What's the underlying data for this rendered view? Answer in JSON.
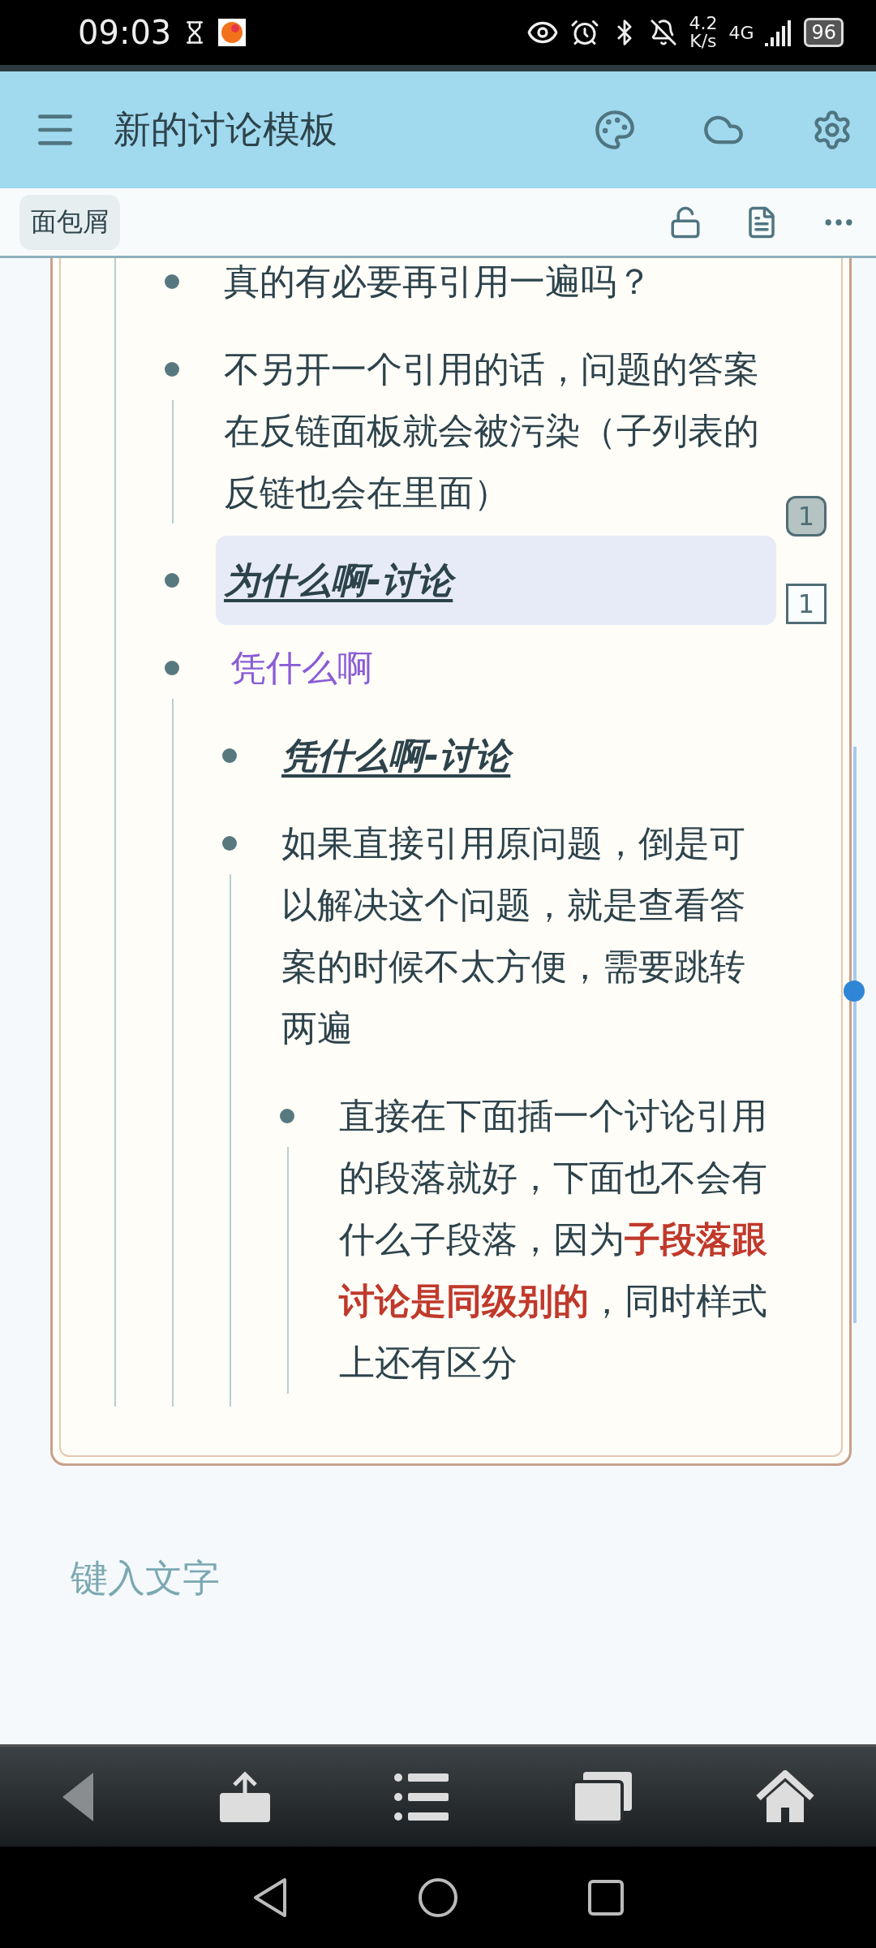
{
  "status_bar": {
    "time": "09:03",
    "speed": [
      "4.2",
      "K/s"
    ],
    "network": "4G",
    "battery": "96"
  },
  "app_bar": {
    "title": "新的讨论模板"
  },
  "toolbar": {
    "breadcrumb": "面包屑"
  },
  "outline": [
    {
      "text": "真的有必要再引用一遍吗？",
      "kind": "text",
      "selected": false
    },
    {
      "text": "不另开一个引用的话，问题的答案在反链面板就会被污染（子列表的反链也会在里面）",
      "kind": "text",
      "selected": false
    },
    {
      "text": "为什么啊-讨论",
      "kind": "reference",
      "selected": true,
      "badges": [
        {
          "label": "1",
          "filled": true
        },
        {
          "label": "1",
          "filled": false
        }
      ]
    },
    {
      "text": "凭什么啊",
      "kind": "tag",
      "selected": false,
      "children": [
        {
          "text": "凭什么啊-讨论",
          "kind": "reference",
          "selected": false
        },
        {
          "text": "如果直接引用原问题，倒是可以解决这个问题，就是查看答案的时候不太方便，需要跳转两遍",
          "kind": "text",
          "selected": false,
          "children": [
            {
              "text": "直接在下面插一个讨论引用的段落就好，下面也不会有什么子段落，因为**子段落跟讨论是同级别的**，同时样式上还有区分",
              "kind": "text",
              "selected": false
            }
          ]
        }
      ]
    }
  ],
  "editor": {
    "placeholder": "键入文字"
  }
}
